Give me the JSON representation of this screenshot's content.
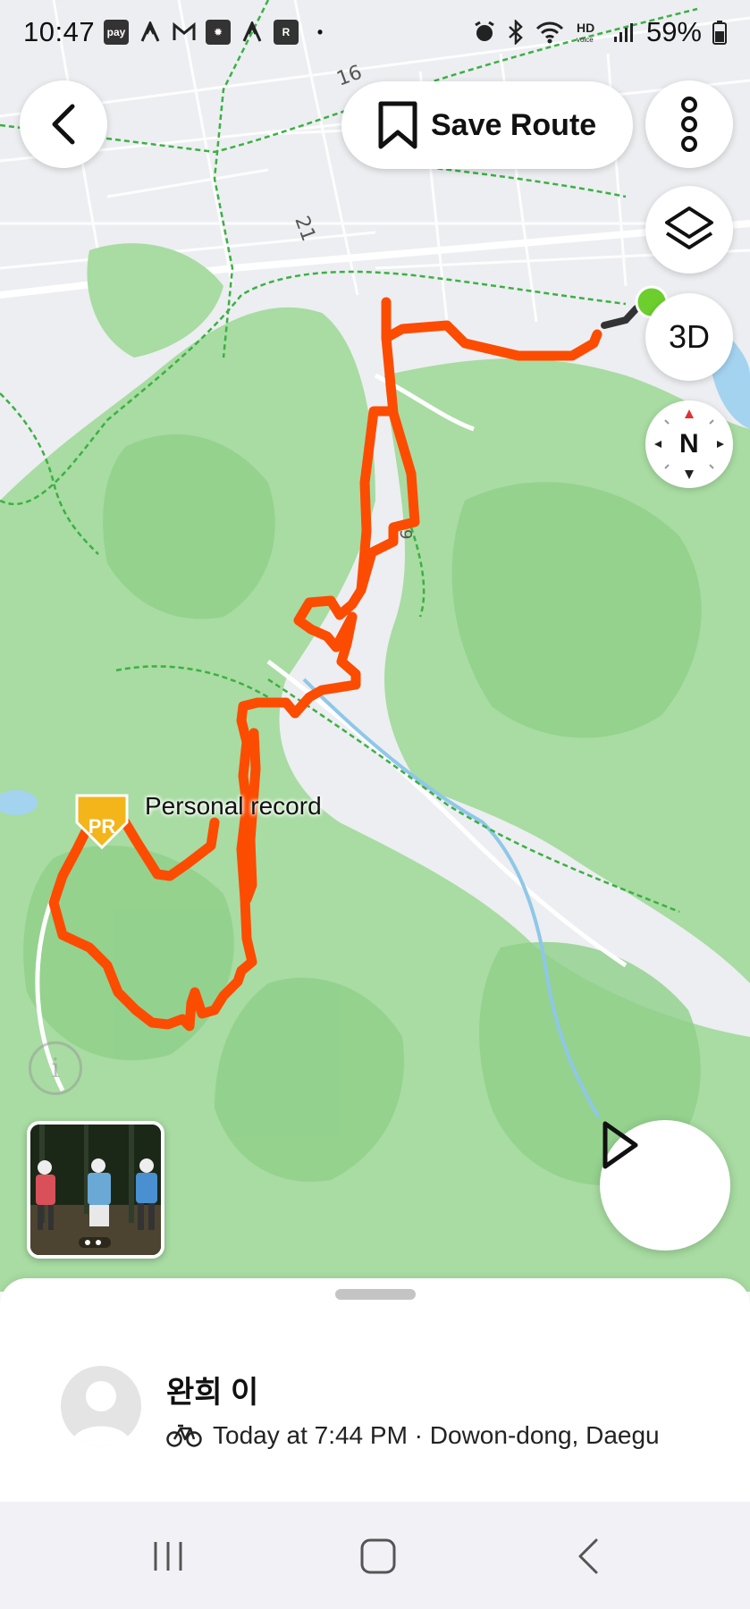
{
  "status_bar": {
    "time": "10:47",
    "battery": "59%",
    "left_icons": [
      "pay-icon",
      "strava-icon",
      "gmail-icon",
      "bulb-app-icon",
      "strava-icon",
      "app-icon",
      "dot-icon"
    ],
    "right_icons": [
      "alarm-icon",
      "bluetooth-icon",
      "wifi-icon",
      "hd-voice-icon",
      "signal-icon",
      "battery-icon"
    ]
  },
  "top_bar": {
    "back_icon": "chevron-left-icon",
    "save_route_label": "Save Route",
    "save_route_icon": "bookmark-icon",
    "more_icon": "vertical-dots-icon"
  },
  "map_controls": {
    "layers_icon": "layers-icon",
    "threed_label": "3D",
    "compass_label": "N"
  },
  "map": {
    "road_labels": [
      "16",
      "21",
      "9"
    ],
    "pr_badge": "PR",
    "pr_label": "Personal record",
    "route_color": "#fc4c02",
    "start_marker_color": "#6ccf2e",
    "info_icon": "i"
  },
  "activity_sheet": {
    "user_name": "완희 이",
    "activity_icon": "bicycle-icon",
    "meta": "Today at 7:44 PM · Dowon-dong, Daegu"
  },
  "nav_bar": {
    "recents_icon": "recent-apps-icon",
    "home_icon": "home-icon",
    "back_icon": "back-icon"
  }
}
